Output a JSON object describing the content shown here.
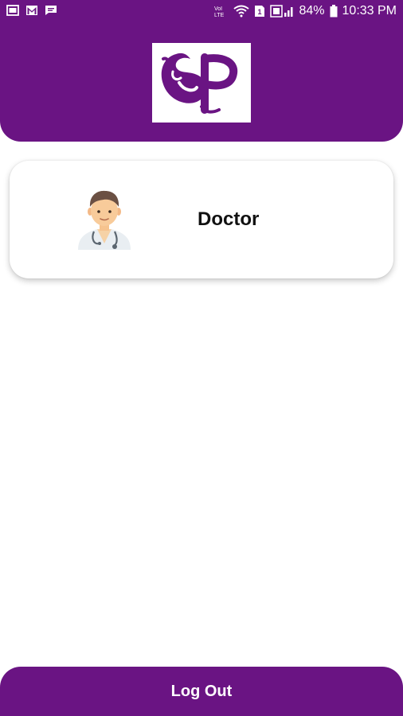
{
  "status_bar": {
    "battery": "84%",
    "time": "10:33 PM",
    "icons_left": [
      "gallery-icon",
      "gmail-icon",
      "message-icon"
    ],
    "icons_right": [
      "volte-icon",
      "wifi-icon",
      "sim-icon",
      "signal-icon",
      "battery-icon"
    ]
  },
  "header": {
    "logo_text": "SP",
    "brand_color": "#6a1483"
  },
  "cards": [
    {
      "label": "Doctor",
      "icon": "doctor-avatar-icon"
    }
  ],
  "footer": {
    "logout_label": "Log Out"
  }
}
